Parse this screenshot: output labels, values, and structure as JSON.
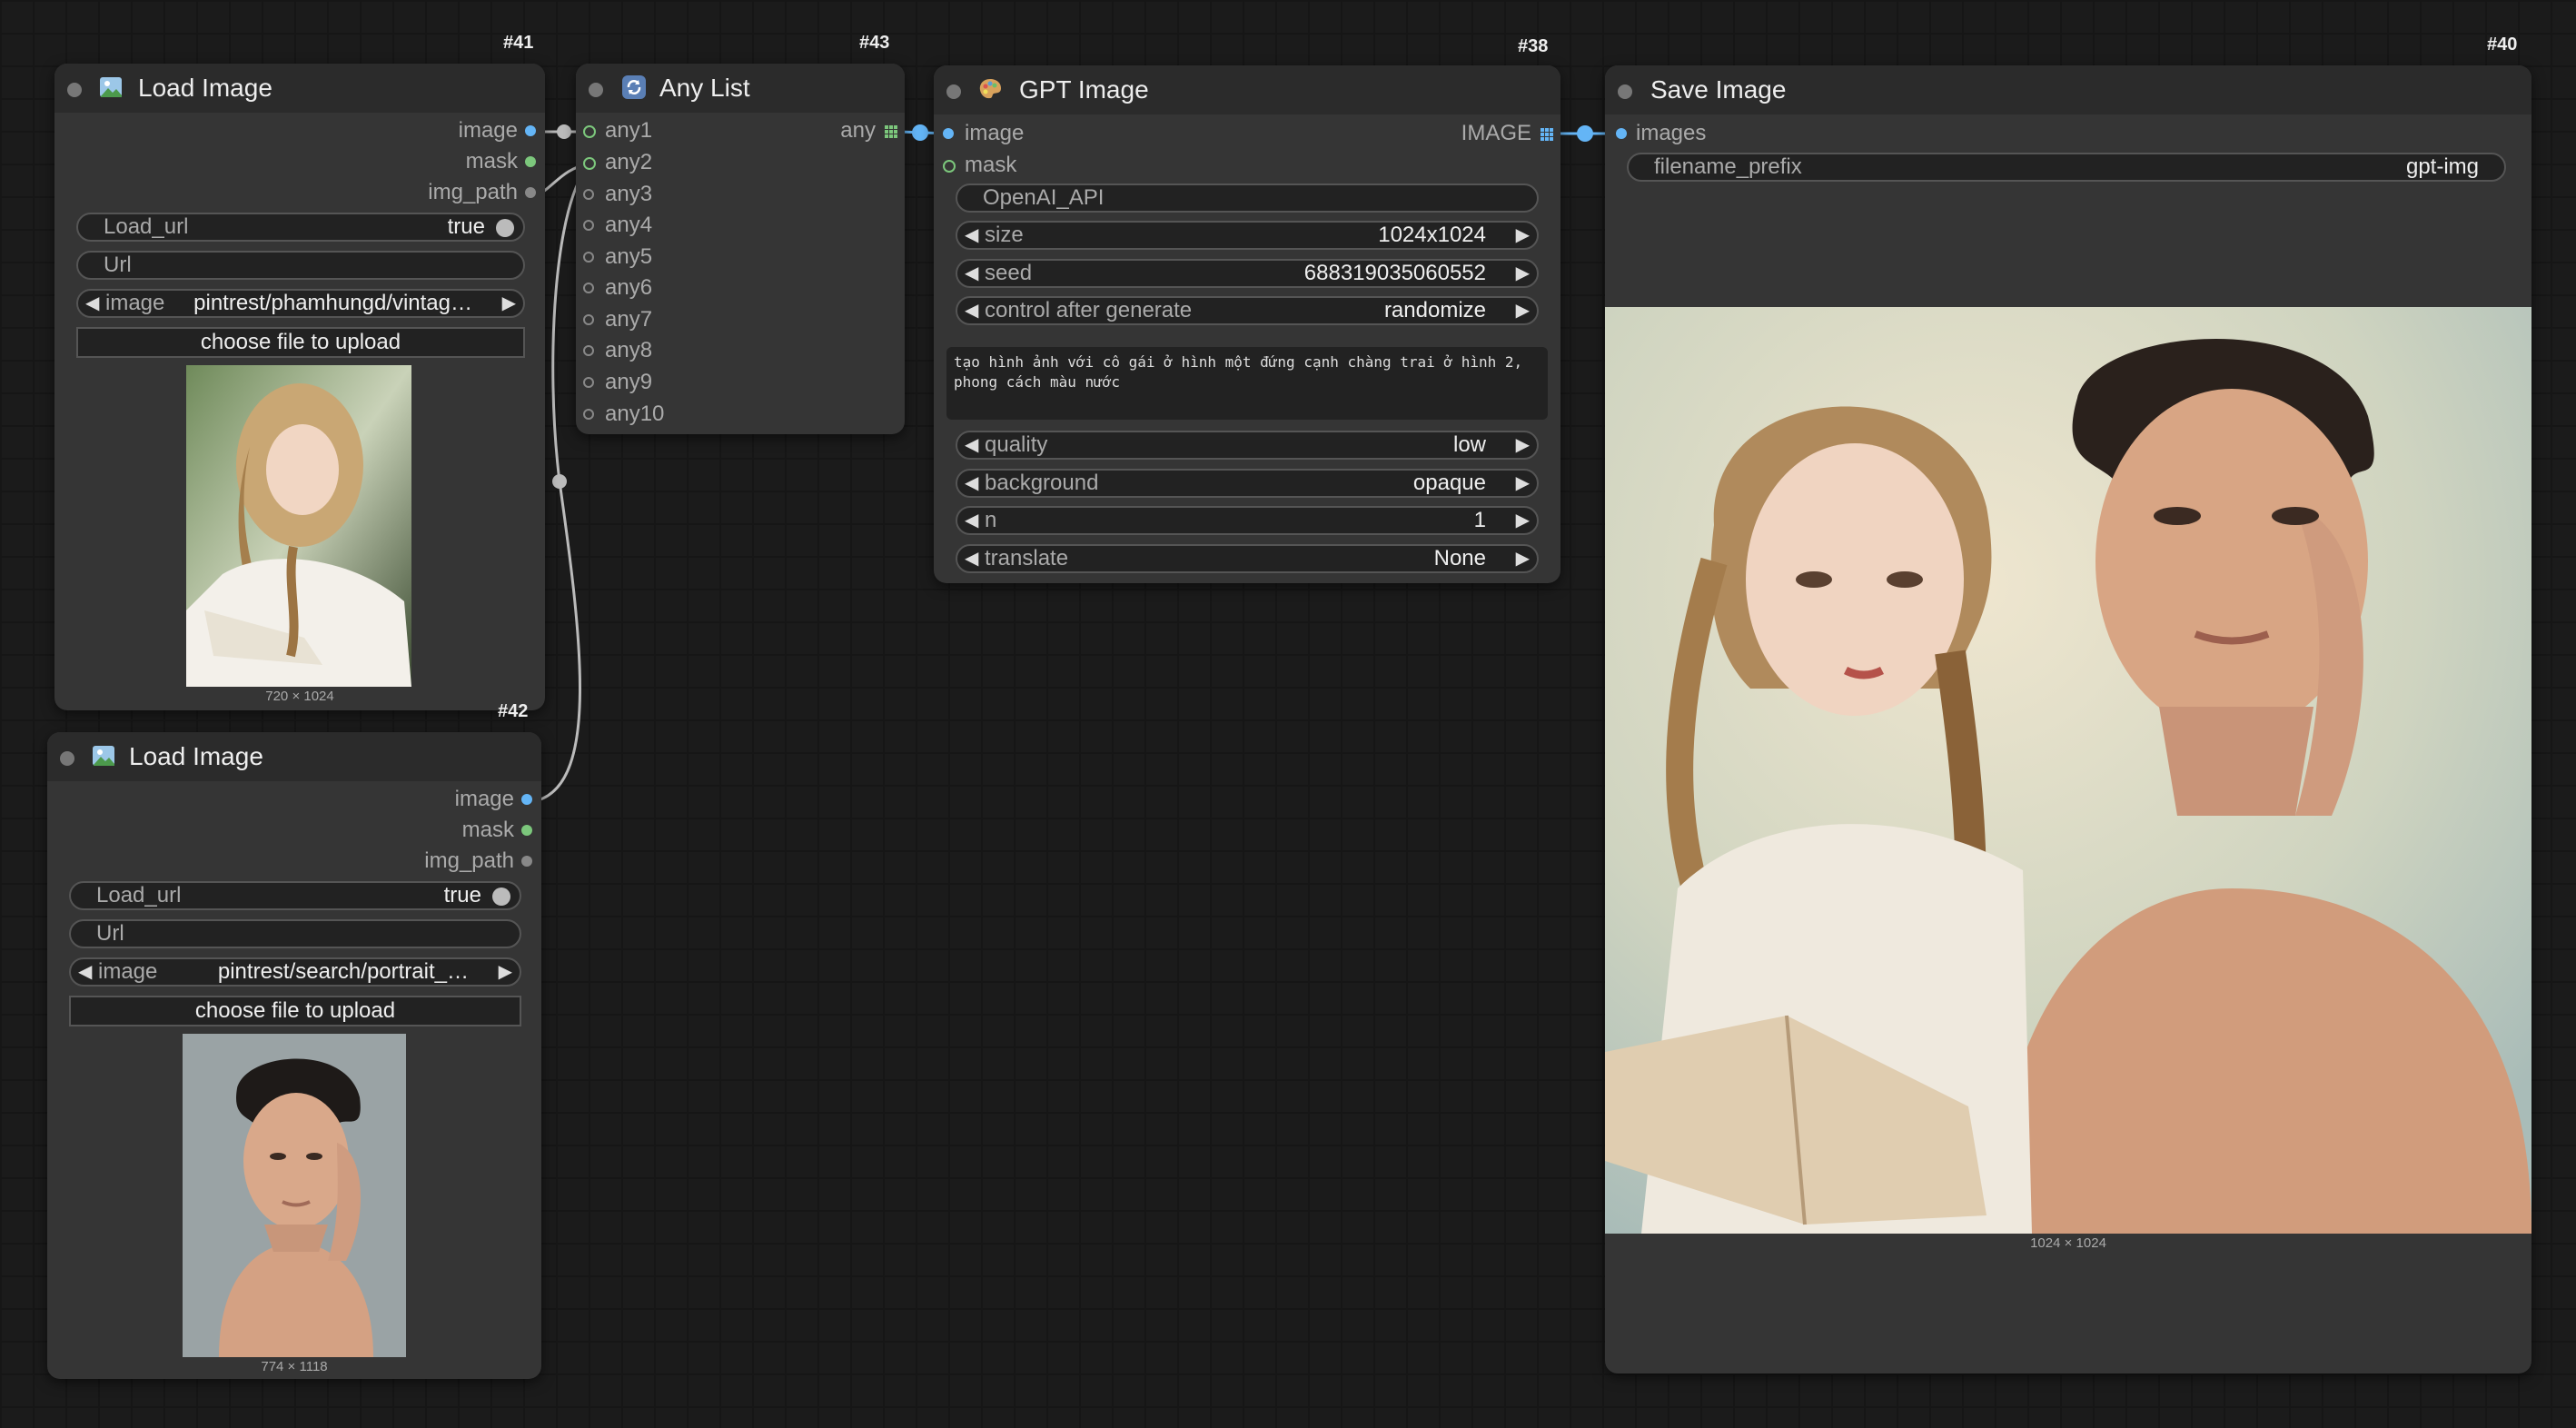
{
  "nodes": {
    "load1": {
      "id": "#41",
      "title": "Load Image",
      "outputs": [
        "image",
        "mask",
        "img_path"
      ],
      "load_url_label": "Load_url",
      "load_url_value": "true",
      "url_label": "Url",
      "image_label": "image",
      "image_value": "pintrest/phamhungd/vintag…",
      "upload_label": "choose file to upload",
      "preview_caption": "720 × 1024"
    },
    "load2": {
      "id": "#42",
      "title": "Load Image",
      "outputs": [
        "image",
        "mask",
        "img_path"
      ],
      "load_url_label": "Load_url",
      "load_url_value": "true",
      "url_label": "Url",
      "image_label": "image",
      "image_value": "pintrest/search/portrait_…",
      "upload_label": "choose file to upload",
      "preview_caption": "774 × 1118"
    },
    "anylist": {
      "id": "#43",
      "title": "Any List",
      "inputs": [
        "any1",
        "any2",
        "any3",
        "any4",
        "any5",
        "any6",
        "any7",
        "any8",
        "any9",
        "any10"
      ],
      "output": "any"
    },
    "gpt": {
      "id": "#38",
      "title": "GPT Image",
      "inputs": [
        "image",
        "mask"
      ],
      "output": "IMAGE",
      "api_label": "OpenAI_API",
      "size_label": "size",
      "size_value": "1024x1024",
      "seed_label": "seed",
      "seed_value": "688319035060552",
      "control_label": "control after generate",
      "control_value": "randomize",
      "prompt": "tạo hình ảnh với cô gái ở hình một đứng cạnh chàng trai ở hình 2, phong cách màu nước",
      "quality_label": "quality",
      "quality_value": "low",
      "background_label": "background",
      "background_value": "opaque",
      "n_label": "n",
      "n_value": "1",
      "translate_label": "translate",
      "translate_value": "None"
    },
    "save": {
      "id": "#40",
      "title": "Save Image",
      "input": "images",
      "prefix_label": "filename_prefix",
      "prefix_value": "gpt-img",
      "preview_caption": "1024 × 1024"
    }
  },
  "colors": {
    "image_link": "#64b5f6",
    "mask_link": "#7cc77c",
    "wire": "#bbbbbb"
  }
}
